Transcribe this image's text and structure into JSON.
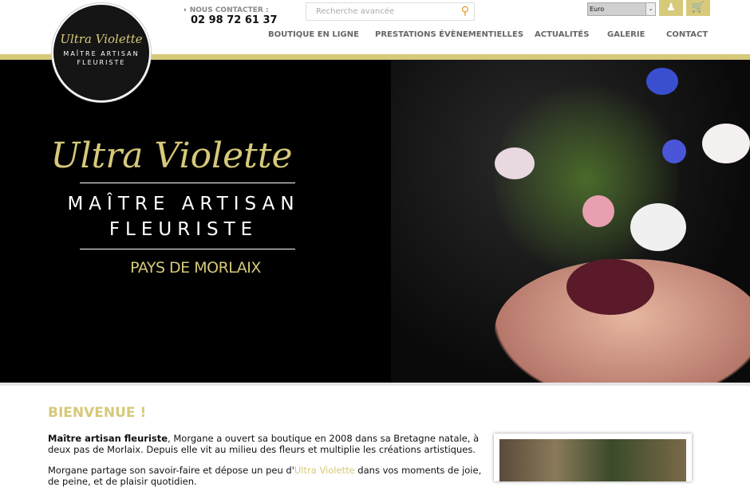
{
  "logo": {
    "script": "Ultra Violette",
    "line1": "MAÎTRE ARTISAN",
    "line2": "FLEURISTE"
  },
  "contact": {
    "label": "NOUS CONTACTER :",
    "phone": "02 98 72 61 37"
  },
  "search": {
    "placeholder": "Recherche avancée",
    "icon": "search-icon"
  },
  "currency": {
    "selected": "Euro"
  },
  "nav": [
    "BOUTIQUE EN LIGNE",
    "PRESTATIONS ÉVÈNEMENTIELLES",
    "ACTUALITÉS",
    "GALERIE",
    "CONTACT"
  ],
  "hero": {
    "script": "Ultra Violette",
    "line1": "MAÎTRE ARTISAN",
    "line2": "FLEURISTE",
    "region": "PAYS DE MORLAIX"
  },
  "welcome": {
    "title": "BIENVENUE !",
    "p1_bold": "Maître artisan fleuriste",
    "p1_rest": ", Morgane a ouvert sa boutique en 2008 dans sa Bretagne natale, à deux pas de Morlaix. Depuis elle vit au milieu des fleurs et multiplie les créations artistiques.",
    "p2_start": "Morgane partage son savoir-faire et dépose un peu d'",
    "p2_brand": "Ultra Violette",
    "p2_end": " dans vos moments de joie, de peine, et de plaisir quotidien."
  },
  "colors": {
    "gold": "#d6c97a",
    "search_icon": "#e69a2e"
  }
}
